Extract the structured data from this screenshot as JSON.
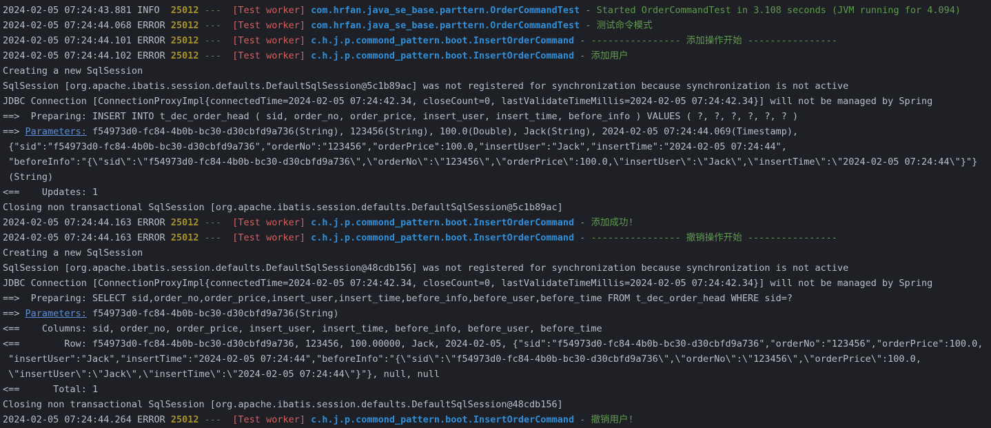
{
  "console": {
    "background": "#1e2025",
    "colors": {
      "timestamp": "#b9bfc7",
      "level": "#b9bfc7",
      "pid": "#a6932a",
      "thread": "#e05c5c",
      "logger": "#2f8fd8",
      "message": "#5f9a4e",
      "plain": "#b9bfc7",
      "link": "#5b8fd8",
      "dashes": "#5f7a55"
    },
    "lines": [
      {
        "type": "log",
        "timestamp": "2024-02-05 07:24:43.881",
        "level": "INFO ",
        "pid": "25012",
        "dashes": "---",
        "thread": "[Test worker]",
        "logger": "com.hrfan.java_se_base.parttern.OrderCommandTest",
        "separator": "-",
        "message": "Started OrderCommandTest in 3.108 seconds (JVM running for 4.094)"
      },
      {
        "type": "log",
        "timestamp": "2024-02-05 07:24:44.068",
        "level": "ERROR",
        "pid": "25012",
        "dashes": "---",
        "thread": "[Test worker]",
        "logger": "com.hrfan.java_se_base.parttern.OrderCommandTest",
        "separator": "-",
        "message": "测试命令模式"
      },
      {
        "type": "log",
        "timestamp": "2024-02-05 07:24:44.101",
        "level": "ERROR",
        "pid": "25012",
        "dashes": "---",
        "thread": "[Test worker]",
        "logger": "c.h.j.p.commond_pattern.boot.InsertOrderCommand",
        "separator": "-",
        "message": "---------------- 添加操作开始 ----------------"
      },
      {
        "type": "log",
        "timestamp": "2024-02-05 07:24:44.102",
        "level": "ERROR",
        "pid": "25012",
        "dashes": "---",
        "thread": "[Test worker]",
        "logger": "c.h.j.p.commond_pattern.boot.InsertOrderCommand",
        "separator": "-",
        "message": "添加用户"
      },
      {
        "type": "plain",
        "text": "Creating a new SqlSession"
      },
      {
        "type": "plain",
        "text": "SqlSession [org.apache.ibatis.session.defaults.DefaultSqlSession@5c1b89ac] was not registered for synchronization because synchronization is not active"
      },
      {
        "type": "plain",
        "text": "JDBC Connection [ConnectionProxyImpl{connectedTime=2024-02-05 07:24:42.34, closeCount=0, lastValidateTimeMillis=2024-02-05 07:24:42.34}] will not be managed by Spring"
      },
      {
        "type": "plain",
        "text": "==>  Preparing: INSERT INTO t_dec_order_head ( sid, order_no, order_price, insert_user, insert_time, before_info ) VALUES ( ?, ?, ?, ?, ?, ? )"
      },
      {
        "type": "link",
        "prefix": "==> ",
        "link": "Parameters:",
        "suffix": " f54973d0-fc84-4b0b-bc30-d30cbfd9a736(String), 123456(String), 100.0(Double), Jack(String), 2024-02-05 07:24:44.069(Timestamp),"
      },
      {
        "type": "plain",
        "text": " {\"sid\":\"f54973d0-fc84-4b0b-bc30-d30cbfd9a736\",\"orderNo\":\"123456\",\"orderPrice\":100.0,\"insertUser\":\"Jack\",\"insertTime\":\"2024-02-05 07:24:44\","
      },
      {
        "type": "plain",
        "text": " \"beforeInfo\":\"{\\\"sid\\\":\\\"f54973d0-fc84-4b0b-bc30-d30cbfd9a736\\\",\\\"orderNo\\\":\\\"123456\\\",\\\"orderPrice\\\":100.0,\\\"insertUser\\\":\\\"Jack\\\",\\\"insertTime\\\":\\\"2024-02-05 07:24:44\\\"}\"}"
      },
      {
        "type": "plain",
        "text": " (String)"
      },
      {
        "type": "plain",
        "text": "<==    Updates: 1"
      },
      {
        "type": "plain",
        "text": "Closing non transactional SqlSession [org.apache.ibatis.session.defaults.DefaultSqlSession@5c1b89ac]"
      },
      {
        "type": "log",
        "timestamp": "2024-02-05 07:24:44.163",
        "level": "ERROR",
        "pid": "25012",
        "dashes": "---",
        "thread": "[Test worker]",
        "logger": "c.h.j.p.commond_pattern.boot.InsertOrderCommand",
        "separator": "-",
        "message": "添加成功!"
      },
      {
        "type": "log",
        "timestamp": "2024-02-05 07:24:44.163",
        "level": "ERROR",
        "pid": "25012",
        "dashes": "---",
        "thread": "[Test worker]",
        "logger": "c.h.j.p.commond_pattern.boot.InsertOrderCommand",
        "separator": "-",
        "message": "---------------- 撤销操作开始 ----------------"
      },
      {
        "type": "plain",
        "text": "Creating a new SqlSession"
      },
      {
        "type": "plain",
        "text": "SqlSession [org.apache.ibatis.session.defaults.DefaultSqlSession@48cdb156] was not registered for synchronization because synchronization is not active"
      },
      {
        "type": "plain",
        "text": "JDBC Connection [ConnectionProxyImpl{connectedTime=2024-02-05 07:24:42.34, closeCount=0, lastValidateTimeMillis=2024-02-05 07:24:42.34}] will not be managed by Spring"
      },
      {
        "type": "plain",
        "text": "==>  Preparing: SELECT sid,order_no,order_price,insert_user,insert_time,before_info,before_user,before_time FROM t_dec_order_head WHERE sid=?"
      },
      {
        "type": "link",
        "prefix": "==> ",
        "link": "Parameters:",
        "suffix": " f54973d0-fc84-4b0b-bc30-d30cbfd9a736(String)"
      },
      {
        "type": "plain",
        "text": "<==    Columns: sid, order_no, order_price, insert_user, insert_time, before_info, before_user, before_time"
      },
      {
        "type": "plain",
        "text": "<==        Row: f54973d0-fc84-4b0b-bc30-d30cbfd9a736, 123456, 100.00000, Jack, 2024-02-05, {\"sid\":\"f54973d0-fc84-4b0b-bc30-d30cbfd9a736\",\"orderNo\":\"123456\",\"orderPrice\":100.0,"
      },
      {
        "type": "plain",
        "text": " \"insertUser\":\"Jack\",\"insertTime\":\"2024-02-05 07:24:44\",\"beforeInfo\":\"{\\\"sid\\\":\\\"f54973d0-fc84-4b0b-bc30-d30cbfd9a736\\\",\\\"orderNo\\\":\\\"123456\\\",\\\"orderPrice\\\":100.0,"
      },
      {
        "type": "plain",
        "text": " \\\"insertUser\\\":\\\"Jack\\\",\\\"insertTime\\\":\\\"2024-02-05 07:24:44\\\"}\"}, null, null"
      },
      {
        "type": "plain",
        "text": "<==      Total: 1"
      },
      {
        "type": "plain",
        "text": "Closing non transactional SqlSession [org.apache.ibatis.session.defaults.DefaultSqlSession@48cdb156]"
      },
      {
        "type": "log",
        "timestamp": "2024-02-05 07:24:44.264",
        "level": "ERROR",
        "pid": "25012",
        "dashes": "---",
        "thread": "[Test worker]",
        "logger": "c.h.j.p.commond_pattern.boot.InsertOrderCommand",
        "separator": "-",
        "message": "撤销用户!"
      }
    ]
  }
}
